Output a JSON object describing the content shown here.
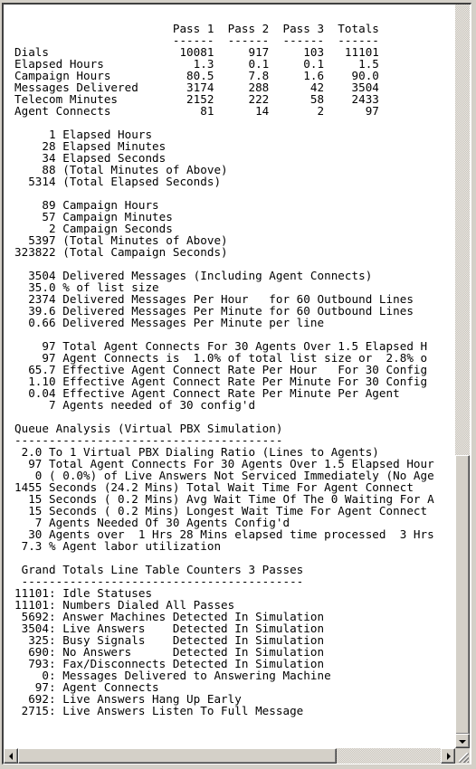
{
  "report": {
    "summary_table": {
      "columns": [
        "Pass 1",
        "Pass 2",
        "Pass 3",
        "Totals"
      ],
      "rows": [
        {
          "label": "Dials",
          "values": [
            "10081",
            "917",
            "103",
            "11101"
          ]
        },
        {
          "label": "Elapsed Hours",
          "values": [
            "1.3",
            "0.1",
            "0.1",
            "1.5"
          ]
        },
        {
          "label": "Campaign Hours",
          "values": [
            "80.5",
            "7.8",
            "1.6",
            "90.0"
          ]
        },
        {
          "label": "Messages Delivered",
          "values": [
            "3174",
            "288",
            "42",
            "3504"
          ]
        },
        {
          "label": "Telecom Minutes",
          "values": [
            "2152",
            "222",
            "58",
            "2433"
          ]
        },
        {
          "label": "Agent Connects",
          "values": [
            "81",
            "14",
            "2",
            "97"
          ]
        }
      ]
    },
    "lines": [
      "                       Pass 1  Pass 2  Pass 3  Totals",
      "                       ------  ------  ------  ------",
      "Dials                   10081     917     103   11101",
      "Elapsed Hours             1.3     0.1     0.1     1.5",
      "Campaign Hours           80.5     7.8     1.6    90.0",
      "Messages Delivered       3174     288      42    3504",
      "Telecom Minutes          2152     222      58    2433",
      "Agent Connects             81      14       2      97",
      "",
      "     1 Elapsed Hours",
      "    28 Elapsed Minutes",
      "    34 Elapsed Seconds",
      "    88 (Total Minutes of Above)",
      "  5314 (Total Elapsed Seconds)",
      "",
      "    89 Campaign Hours",
      "    57 Campaign Minutes",
      "     2 Campaign Seconds",
      "  5397 (Total Minutes of Above)",
      "323822 (Total Campaign Seconds)",
      "",
      "  3504 Delivered Messages (Including Agent Connects)",
      "  35.0 % of list size",
      "  2374 Delivered Messages Per Hour   for 60 Outbound Lines",
      "  39.6 Delivered Messages Per Minute for 60 Outbound Lines",
      "  0.66 Delivered Messages Per Minute per line",
      "",
      "    97 Total Agent Connects For 30 Agents Over 1.5 Elapsed H",
      "    97 Agent Connects is  1.0% of total list size or  2.8% o",
      "  65.7 Effective Agent Connect Rate Per Hour   For 30 Config",
      "  1.10 Effective Agent Connect Rate Per Minute For 30 Config",
      "  0.04 Effective Agent Connect Rate Per Minute Per Agent",
      "     7 Agents needed of 30 config'd",
      "",
      "Queue Analysis (Virtual PBX Simulation)",
      "---------------------------------------",
      " 2.0 To 1 Virtual PBX Dialing Ratio (Lines to Agents)",
      "  97 Total Agent Connects For 30 Agents Over 1.5 Elapsed Hour",
      "   0 ( 0.0%) of Live Answers Not Serviced Immediately (No Age",
      "1455 Seconds (24.2 Mins) Total Wait Time For Agent Connect",
      "  15 Seconds ( 0.2 Mins) Avg Wait Time Of The 0 Waiting For A",
      "  15 Seconds ( 0.2 Mins) Longest Wait Time For Agent Connect",
      "   7 Agents Needed Of 30 Agents Config'd",
      "  30 Agents over  1 Hrs 28 Mins elapsed time processed  3 Hrs",
      " 7.3 % Agent labor utilization",
      "",
      " Grand Totals Line Table Counters 3 Passes",
      " -----------------------------------------",
      "11101: Idle Statuses",
      "11101: Numbers Dialed All Passes",
      " 5692: Answer Machines Detected In Simulation",
      " 3504: Live Answers    Detected In Simulation",
      "  325: Busy Signals    Detected In Simulation",
      "  690: No Answers      Detected In Simulation",
      "  793: Fax/Disconnects Detected In Simulation",
      "    0: Messages Delivered to Answering Machine",
      "   97: Agent Connects",
      "  692: Live Answers Hang Up Early",
      " 2715: Live Answers Listen To Full Message"
    ]
  },
  "scrollbars": {
    "vertical_position_fraction": 0.78,
    "horizontal_position_fraction": 0.0
  },
  "icons": {
    "scroll_down": "down-arrow-icon",
    "scroll_left": "left-arrow-icon",
    "scroll_right": "right-arrow-icon",
    "resize_grip": "resize-grip-icon"
  }
}
